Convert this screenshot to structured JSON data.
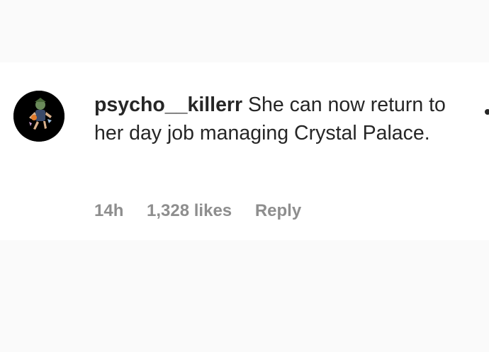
{
  "comment": {
    "username": "psycho__killerr",
    "text": "She can now return to her day job managing Crystal Palace.",
    "time": "14h",
    "likes": "1,328 likes",
    "reply_label": "Reply",
    "avatar_icon": "avatar-character-icon",
    "more_icon": "more-options-icon"
  },
  "colors": {
    "page_background": "#fafafa",
    "card_background": "#ffffff",
    "primary_text": "#262626",
    "secondary_text": "#8e8e8e"
  }
}
